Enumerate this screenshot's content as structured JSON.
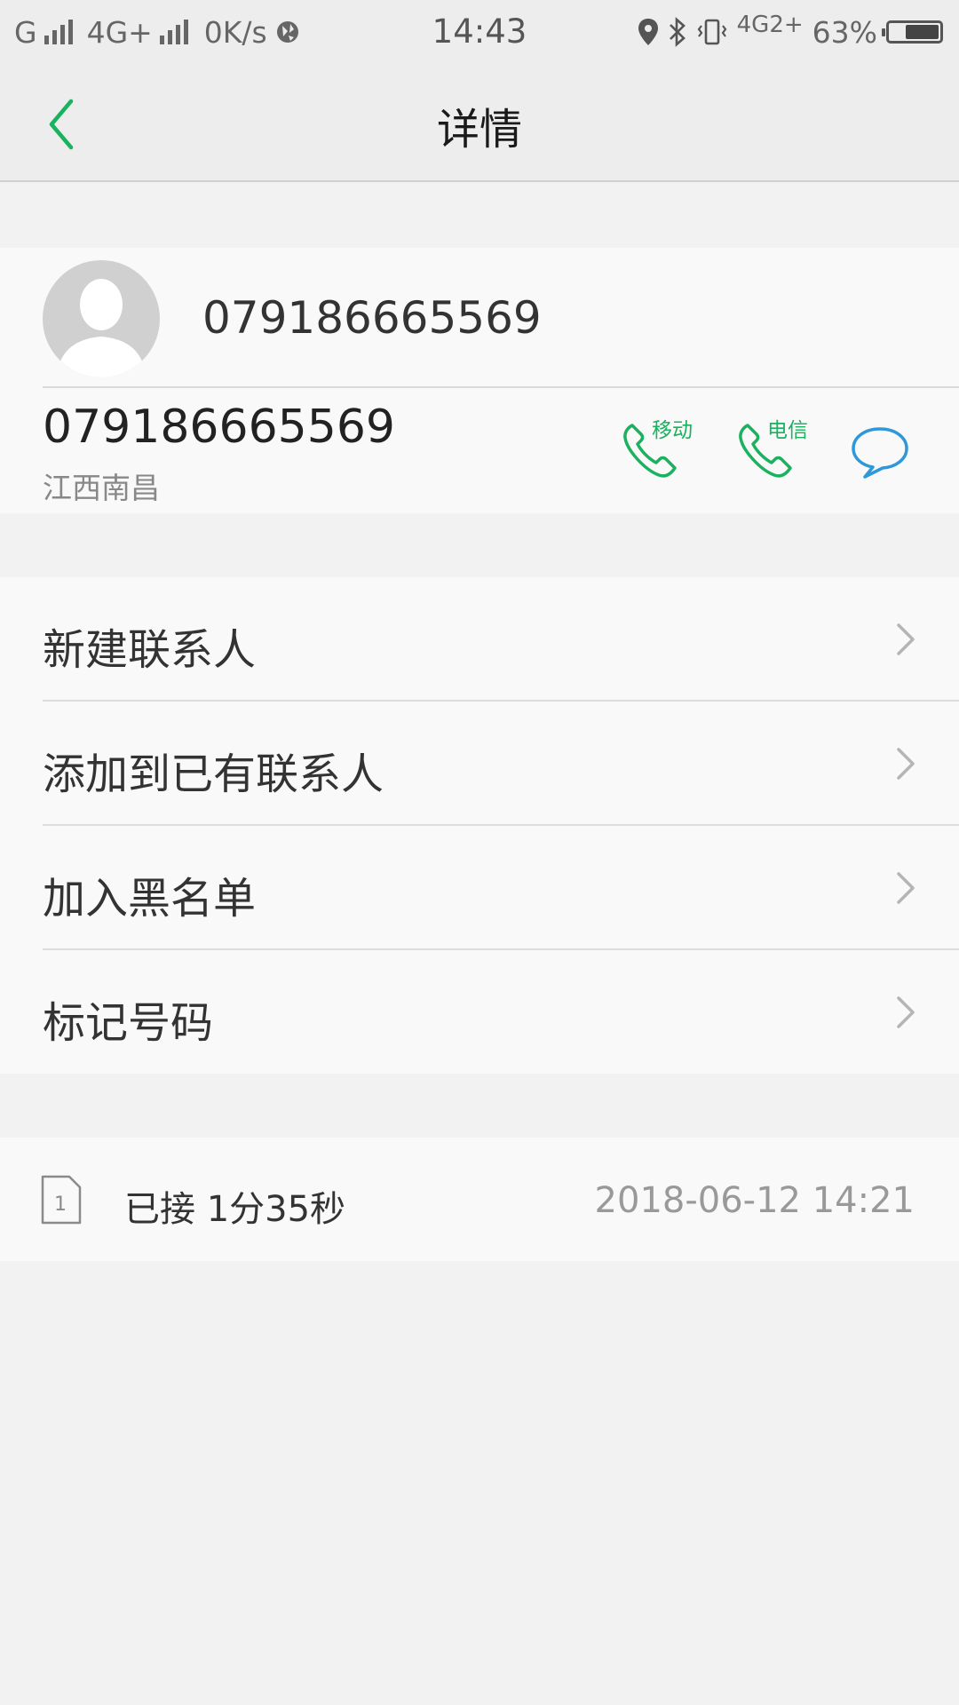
{
  "status_bar": {
    "carrier_1": "G",
    "carrier_2": "4G+",
    "speed": "0K/s",
    "time": "14:43",
    "network_right": "4G",
    "network_sub": "2+",
    "battery": "63%",
    "battery_level": 0.63
  },
  "header": {
    "title": "详情"
  },
  "contact": {
    "header_number": "079186665569",
    "number": "079186665569",
    "location": "江西南昌",
    "call_sim1_label": "移动",
    "call_sim2_label": "电信"
  },
  "menu": {
    "items": [
      {
        "label": "新建联系人"
      },
      {
        "label": "添加到已有联系人"
      },
      {
        "label": "加入黑名单"
      },
      {
        "label": "标记号码"
      }
    ]
  },
  "history": {
    "sim_number": "1",
    "status": "已接 1分35秒",
    "timestamp": "2018-06-12 14:21"
  },
  "colors": {
    "accent_green": "#19b25e",
    "message_blue": "#2f98d8"
  }
}
